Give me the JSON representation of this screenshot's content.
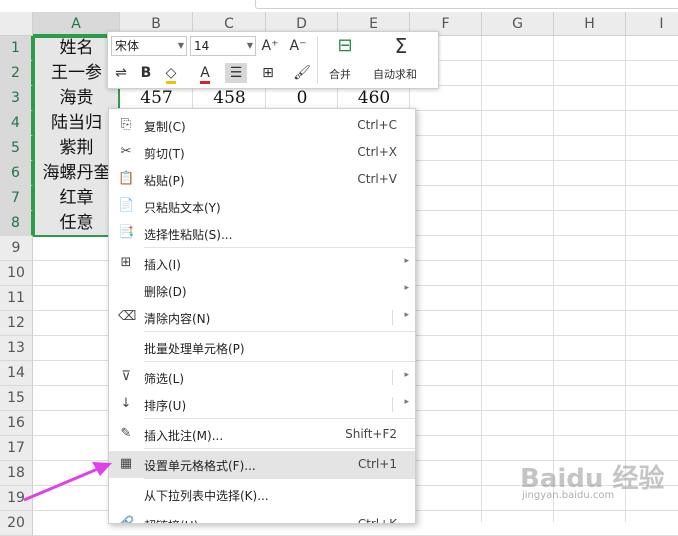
{
  "columns": [
    "A",
    "B",
    "C",
    "D",
    "E",
    "F",
    "G",
    "H",
    "I"
  ],
  "rows": [
    "1",
    "2",
    "3",
    "4",
    "5",
    "6",
    "7",
    "8",
    "9",
    "10",
    "11",
    "12",
    "13",
    "14",
    "15",
    "16",
    "17",
    "18",
    "19",
    "20"
  ],
  "cells": {
    "A1": "姓名",
    "A2": "王一参",
    "A3": "海贵",
    "A4": "陆当归",
    "A5": "紫荆",
    "A6": "海螺丹奎",
    "A7": "红章",
    "A8": "任意",
    "B3": "457",
    "C3": "458",
    "D3": "0",
    "E3": "460"
  },
  "mini_toolbar": {
    "font_name": "宋体",
    "font_size": "14",
    "increase_font": "A⁺",
    "decrease_font": "A⁻",
    "bold": "B",
    "merge_label": "合并",
    "autosum_label": "自动求和"
  },
  "context_menu": [
    {
      "icon": "copy-icon",
      "glyph": "⎘",
      "label": "复制(C)",
      "shortcut": "Ctrl+C"
    },
    {
      "icon": "cut-icon",
      "glyph": "✂",
      "label": "剪切(T)",
      "shortcut": "Ctrl+X"
    },
    {
      "icon": "paste-icon",
      "glyph": "📋",
      "label": "粘贴(P)",
      "shortcut": "Ctrl+V"
    },
    {
      "icon": "paste-text-icon",
      "glyph": "📄",
      "label": "只粘贴文本(Y)",
      "shortcut": ""
    },
    {
      "icon": "paste-special-icon",
      "glyph": "📑",
      "label": "选择性粘贴(S)...",
      "shortcut": ""
    },
    {
      "icon": "insert-icon",
      "glyph": "⊞",
      "label": "插入(I)",
      "shortcut": ""
    },
    {
      "icon": "",
      "glyph": "",
      "label": "删除(D)",
      "shortcut": ""
    },
    {
      "icon": "clear-content-icon",
      "glyph": "⌫",
      "label": "清除内容(N)",
      "shortcut": ""
    },
    {
      "icon": "",
      "glyph": "",
      "label": "批量处理单元格(P)",
      "shortcut": ""
    },
    {
      "icon": "filter-icon",
      "glyph": "⊽",
      "label": "筛选(L)",
      "shortcut": ""
    },
    {
      "icon": "sort-icon",
      "glyph": "↓",
      "label": "排序(U)",
      "shortcut": ""
    },
    {
      "icon": "insert-comment-icon",
      "glyph": "✎",
      "label": "插入批注(M)...",
      "shortcut": "Shift+F2"
    },
    {
      "icon": "format-cells-icon",
      "glyph": "▦",
      "label": "设置单元格格式(F)...",
      "shortcut": "Ctrl+1"
    },
    {
      "icon": "",
      "glyph": "",
      "label": "从下拉列表中选择(K)...",
      "shortcut": ""
    },
    {
      "icon": "hyperlink-icon",
      "glyph": "🔗",
      "label": "超链接(H)...",
      "shortcut": "Ctrl+K"
    }
  ],
  "watermark": {
    "main": "Baidu 经验",
    "sub": "jingyan.baidu.com"
  },
  "colors": {
    "selection": "#2a9c4a",
    "arrow": "#e040e8"
  }
}
